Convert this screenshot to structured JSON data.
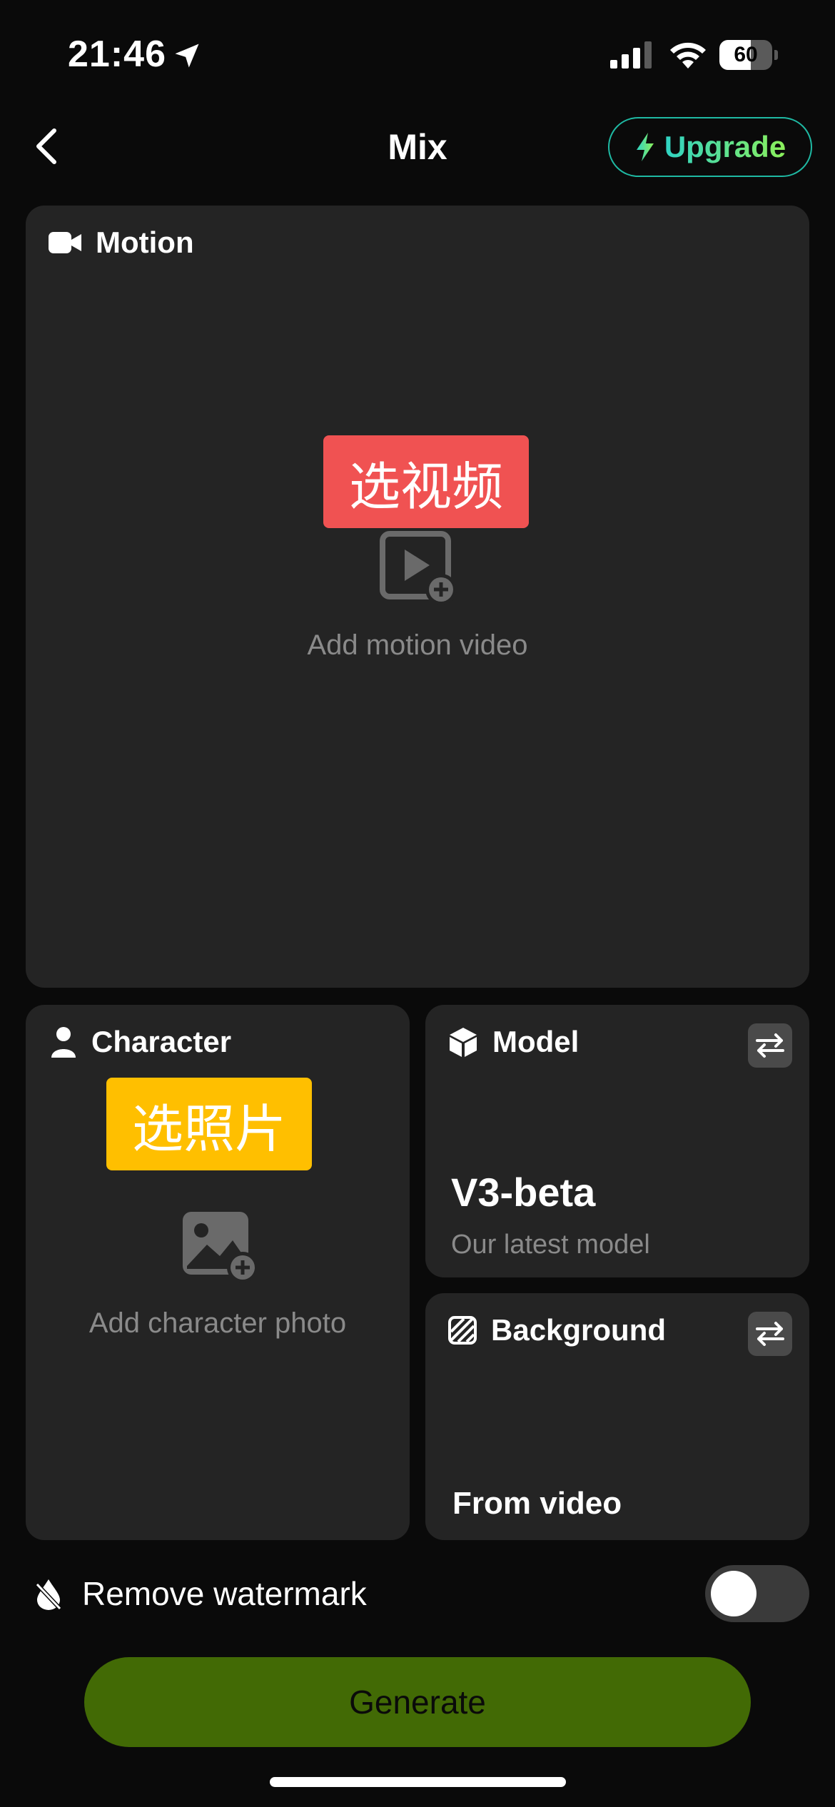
{
  "status_bar": {
    "time": "21:46",
    "battery_level": "60",
    "battery_fraction": 0.6,
    "icons": [
      "location-arrow-icon",
      "cellular-signal-icon",
      "wifi-icon",
      "battery-icon"
    ]
  },
  "header": {
    "title": "Mix",
    "back_icon": "chevron-left-icon",
    "upgrade_label": "Upgrade",
    "upgrade_icon": "lightning-bolt-icon"
  },
  "motion_card": {
    "title": "Motion",
    "icon": "video-camera-icon",
    "overlay_tag": "选视频",
    "placeholder": "Add motion video",
    "placeholder_icon": "add-video-icon"
  },
  "character_card": {
    "title": "Character",
    "icon": "person-icon",
    "overlay_tag": "选照片",
    "placeholder": "Add character photo",
    "placeholder_icon": "add-photo-icon"
  },
  "model_card": {
    "title": "Model",
    "icon": "cube-icon",
    "value": "V3-beta",
    "description": "Our latest model",
    "swap_icon": "swap-arrows-icon"
  },
  "background_card": {
    "title": "Background",
    "icon": "hatched-square-icon",
    "value": "From video",
    "swap_icon": "swap-arrows-icon"
  },
  "watermark": {
    "label": "Remove watermark",
    "icon": "water-drop-off-icon",
    "enabled": false
  },
  "generate": {
    "label": "Generate"
  },
  "colors": {
    "background": "#0a0a0a",
    "card": "#242424",
    "accent_green": "#426a05",
    "upgrade_border": "#1fb9a3",
    "tag_red": "#f05252",
    "tag_yellow": "#ffbf00"
  }
}
